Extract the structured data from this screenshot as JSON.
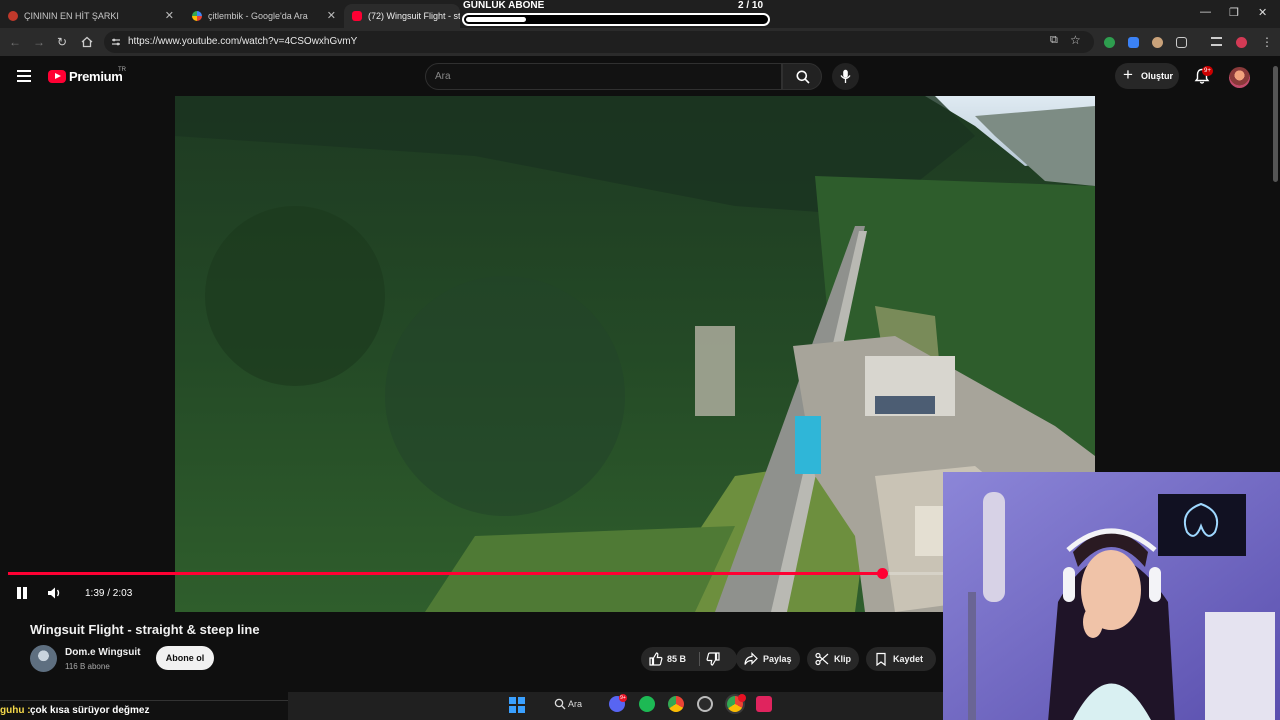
{
  "browser": {
    "tabs": [
      {
        "title": "ÇINININ EN HİT ŞARKI",
        "active": false
      },
      {
        "title": "çitlembik - Google'da Ara",
        "active": false
      },
      {
        "title": "(72) Wingsuit Flight - straig",
        "active": true
      }
    ],
    "url": "https://www.youtube.com/watch?v=4CSOwxhGvmY"
  },
  "overlay": {
    "label": "GÜNLÜK ABONE",
    "count": "2 / 10",
    "progress": 0.2
  },
  "youtube": {
    "brand": "Premium",
    "country": "TR",
    "search_placeholder": "Ara",
    "create_label": "Oluştur",
    "notification_badge": "9+"
  },
  "player": {
    "time": "1:39 / 2:03",
    "progress": 0.805,
    "playing": true
  },
  "video": {
    "title": "Wingsuit Flight - straight & steep line",
    "channel": "Dom.e Wingsuit",
    "subscribers": "116 B abone",
    "subscribe_label": "Abone ol",
    "likes": "85 B",
    "share_label": "Paylaş",
    "clip_label": "Klip",
    "save_label": "Kaydet"
  },
  "chat": {
    "user": "guhu :",
    "message": "çok kısa sürüyor değmez"
  },
  "taskbar": {
    "search_label": "Ara",
    "discord_badge": "9+"
  },
  "colors": {
    "accent": "#ff0033",
    "background": "#0f0f0f"
  }
}
